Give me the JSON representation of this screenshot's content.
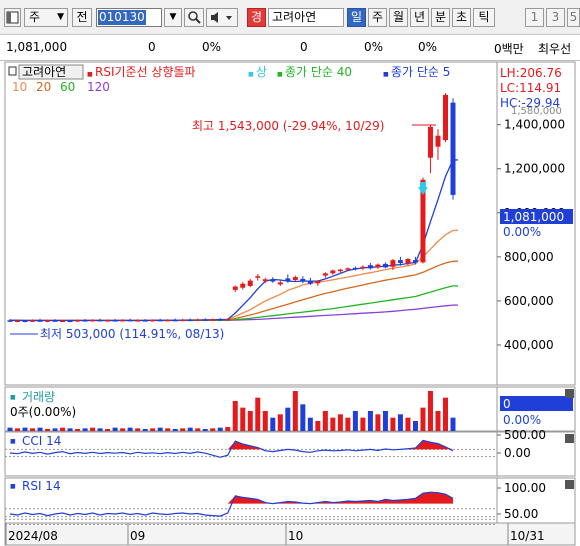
{
  "toolbar": {
    "type_label": "주",
    "type_arrow": "▼",
    "jeon_label": "전",
    "code": "010130",
    "code_dropdown": "▼",
    "search_icon": "search-icon",
    "sound_icon": "speaker-icon",
    "warning_badge": "경",
    "stock_name": "고려아연",
    "periods": [
      "일",
      "주",
      "월",
      "년",
      "분",
      "초",
      "틱"
    ],
    "active_period": "일",
    "number_buttons": [
      "1",
      "3",
      "5"
    ]
  },
  "quote_bar": {
    "price": "1,081,000",
    "change": "0",
    "change_pct": "0%",
    "volume": "0",
    "volume_pct": "0%",
    "extra_pct": "0%",
    "amount": "0백만",
    "trailing": "최우선"
  },
  "price_panel": {
    "legend": {
      "stock": "고려아연",
      "rsi_label": "RSI기준선 상향돌파",
      "arrow_label": "상",
      "ma40": "종가 단순 40",
      "ma5": "종가 단순 5",
      "ma_periods": [
        "10",
        "20",
        "60",
        "120"
      ]
    },
    "lh": "LH:206.76",
    "lc": "LC:114.91",
    "hc": "HC:-29.94",
    "high_annotation": "최고 1,543,000 (-29.94%, 10/29)",
    "low_annotation": "최저 503,000 (114.91%, 08/13)",
    "y_ticks": [
      "1,400,000",
      "1,200,000",
      "1,000,000",
      "800,000",
      "600,000",
      "400,000"
    ],
    "top_clipped_tick": "1,580,000",
    "current_price": "1,081,000",
    "current_pct": "0.00%",
    "colors": {
      "up": "#e41a1c",
      "down": "#1f3fd8",
      "ma5": "#1f3fd8",
      "ma10": "#f08a4b",
      "ma20": "#d2691e",
      "ma60": "#22b522",
      "ma120": "#8b3fd8"
    }
  },
  "volume_panel": {
    "label": "거래량",
    "value": "0주(0.00%)",
    "axis_value": "0",
    "axis_pct": "0.00%"
  },
  "cci_panel": {
    "label": "CCI 14",
    "ticks": [
      "500.00",
      "0.00"
    ]
  },
  "rsi_panel": {
    "label": "RSI 14",
    "ticks": [
      "100.00",
      "50.00"
    ]
  },
  "date_axis": {
    "labels": [
      "2024/08",
      "09",
      "10",
      "10/31"
    ]
  },
  "chart_data": {
    "type": "candlestick",
    "title": "고려아연",
    "xlabel": "",
    "ylabel": "",
    "ylim": [
      300000,
      1580000
    ],
    "dates_range": [
      "2024/08",
      "10/31"
    ],
    "candles": [
      {
        "d": "08/01",
        "o": 512000,
        "h": 518000,
        "l": 505000,
        "c": 509000
      },
      {
        "d": "08/02",
        "o": 509000,
        "h": 515000,
        "l": 503000,
        "c": 511000
      },
      {
        "d": "08/05",
        "o": 511000,
        "h": 514000,
        "l": 503000,
        "c": 506000
      },
      {
        "d": "08/06",
        "o": 506000,
        "h": 516000,
        "l": 504000,
        "c": 512000
      },
      {
        "d": "08/07",
        "o": 512000,
        "h": 519000,
        "l": 506000,
        "c": 508000
      },
      {
        "d": "08/08",
        "o": 508000,
        "h": 515000,
        "l": 503000,
        "c": 512000
      },
      {
        "d": "08/09",
        "o": 512000,
        "h": 517000,
        "l": 507000,
        "c": 509000
      },
      {
        "d": "08/12",
        "o": 509000,
        "h": 514000,
        "l": 504000,
        "c": 511000
      },
      {
        "d": "08/13",
        "o": 511000,
        "h": 515000,
        "l": 503000,
        "c": 507000
      },
      {
        "d": "08/14",
        "o": 507000,
        "h": 516000,
        "l": 505000,
        "c": 513000
      },
      {
        "d": "08/16",
        "o": 513000,
        "h": 518000,
        "l": 507000,
        "c": 510000
      },
      {
        "d": "08/19",
        "o": 510000,
        "h": 517000,
        "l": 506000,
        "c": 514000
      },
      {
        "d": "08/20",
        "o": 514000,
        "h": 519000,
        "l": 509000,
        "c": 511000
      },
      {
        "d": "08/21",
        "o": 511000,
        "h": 516000,
        "l": 507000,
        "c": 513000
      },
      {
        "d": "08/22",
        "o": 513000,
        "h": 518000,
        "l": 508000,
        "c": 510000
      },
      {
        "d": "08/23",
        "o": 510000,
        "h": 517000,
        "l": 506000,
        "c": 514000
      },
      {
        "d": "08/26",
        "o": 514000,
        "h": 519000,
        "l": 509000,
        "c": 511000
      },
      {
        "d": "08/27",
        "o": 511000,
        "h": 517000,
        "l": 507000,
        "c": 513000
      },
      {
        "d": "08/28",
        "o": 513000,
        "h": 518000,
        "l": 508000,
        "c": 510000
      },
      {
        "d": "08/29",
        "o": 510000,
        "h": 516000,
        "l": 506000,
        "c": 514000
      },
      {
        "d": "08/30",
        "o": 514000,
        "h": 519000,
        "l": 509000,
        "c": 512000
      },
      {
        "d": "09/02",
        "o": 512000,
        "h": 517000,
        "l": 507000,
        "c": 514000
      },
      {
        "d": "09/03",
        "o": 514000,
        "h": 520000,
        "l": 509000,
        "c": 513000
      },
      {
        "d": "09/04",
        "o": 513000,
        "h": 519000,
        "l": 508000,
        "c": 515000
      },
      {
        "d": "09/05",
        "o": 515000,
        "h": 520000,
        "l": 510000,
        "c": 514000
      },
      {
        "d": "09/06",
        "o": 514000,
        "h": 520000,
        "l": 509000,
        "c": 516000
      },
      {
        "d": "09/09",
        "o": 516000,
        "h": 521000,
        "l": 511000,
        "c": 514000
      },
      {
        "d": "09/10",
        "o": 514000,
        "h": 520000,
        "l": 510000,
        "c": 517000
      },
      {
        "d": "09/11",
        "o": 517000,
        "h": 522000,
        "l": 512000,
        "c": 515000
      },
      {
        "d": "09/12",
        "o": 515000,
        "h": 521000,
        "l": 511000,
        "c": 518000
      },
      {
        "d": "09/13",
        "o": 650000,
        "h": 670000,
        "l": 640000,
        "c": 665000
      },
      {
        "d": "09/19",
        "o": 660000,
        "h": 685000,
        "l": 652000,
        "c": 678000
      },
      {
        "d": "09/20",
        "o": 668000,
        "h": 700000,
        "l": 662000,
        "c": 692000
      },
      {
        "d": "09/23",
        "o": 705000,
        "h": 722000,
        "l": 692000,
        "c": 712000
      },
      {
        "d": "09/24",
        "o": 690000,
        "h": 705000,
        "l": 680000,
        "c": 698000
      },
      {
        "d": "09/25",
        "o": 698000,
        "h": 708000,
        "l": 682000,
        "c": 688000
      },
      {
        "d": "09/26",
        "o": 675000,
        "h": 692000,
        "l": 668000,
        "c": 684000
      },
      {
        "d": "09/27",
        "o": 702000,
        "h": 720000,
        "l": 682000,
        "c": 690000
      },
      {
        "d": "09/30",
        "o": 695000,
        "h": 715000,
        "l": 688000,
        "c": 708000
      },
      {
        "d": "10/02",
        "o": 700000,
        "h": 712000,
        "l": 680000,
        "c": 688000
      },
      {
        "d": "10/04",
        "o": 690000,
        "h": 705000,
        "l": 672000,
        "c": 678000
      },
      {
        "d": "10/07",
        "o": 680000,
        "h": 694000,
        "l": 668000,
        "c": 690000
      },
      {
        "d": "10/08",
        "o": 715000,
        "h": 730000,
        "l": 705000,
        "c": 725000
      },
      {
        "d": "10/10",
        "o": 725000,
        "h": 742000,
        "l": 718000,
        "c": 738000
      },
      {
        "d": "10/11",
        "o": 735000,
        "h": 746000,
        "l": 726000,
        "c": 742000
      },
      {
        "d": "10/14",
        "o": 742000,
        "h": 752000,
        "l": 735000,
        "c": 748000
      },
      {
        "d": "10/15",
        "o": 750000,
        "h": 756000,
        "l": 738000,
        "c": 744000
      },
      {
        "d": "10/16",
        "o": 748000,
        "h": 762000,
        "l": 740000,
        "c": 755000
      },
      {
        "d": "10/17",
        "o": 762000,
        "h": 772000,
        "l": 742000,
        "c": 748000
      },
      {
        "d": "10/18",
        "o": 752000,
        "h": 770000,
        "l": 745000,
        "c": 765000
      },
      {
        "d": "10/21",
        "o": 768000,
        "h": 775000,
        "l": 748000,
        "c": 752000
      },
      {
        "d": "10/22",
        "o": 755000,
        "h": 790000,
        "l": 740000,
        "c": 785000
      },
      {
        "d": "10/23",
        "o": 785000,
        "h": 800000,
        "l": 760000,
        "c": 772000
      },
      {
        "d": "10/24",
        "o": 770000,
        "h": 795000,
        "l": 760000,
        "c": 790000
      },
      {
        "d": "10/25",
        "o": 785000,
        "h": 800000,
        "l": 766000,
        "c": 775000
      },
      {
        "d": "10/28",
        "o": 775000,
        "h": 1160000,
        "l": 770000,
        "c": 1150000
      },
      {
        "d": "10/29a",
        "o": 1250000,
        "h": 1400000,
        "l": 1180000,
        "c": 1390000
      },
      {
        "d": "10/29b",
        "o": 1300000,
        "h": 1380000,
        "l": 1240000,
        "c": 1350000
      },
      {
        "d": "10/29",
        "o": 1330000,
        "h": 1543000,
        "l": 1320000,
        "c": 1535000
      },
      {
        "d": "10/30",
        "o": 1500000,
        "h": 1520000,
        "l": 1060000,
        "c": 1081000
      }
    ],
    "ma5": [
      512000,
      512000,
      511000,
      511000,
      511000,
      511000,
      511000,
      511000,
      511000,
      511000,
      511000,
      511000,
      511000,
      511000,
      511000,
      511000,
      511000,
      511000,
      511000,
      512000,
      512000,
      512000,
      512000,
      513000,
      513000,
      513000,
      514000,
      514000,
      515000,
      516000,
      545000,
      580000,
      615000,
      655000,
      690000,
      697000,
      695000,
      690000,
      688000,
      690000,
      690000,
      690000,
      700000,
      712000,
      725000,
      738000,
      745000,
      750000,
      752000,
      755000,
      758000,
      762000,
      765000,
      770000,
      775000,
      855000,
      960000,
      1060000,
      1165000,
      1240000,
      1250000
    ],
    "ma10": [
      512000,
      512000,
      512000,
      512000,
      512000,
      512000,
      512000,
      512000,
      512000,
      512000,
      512000,
      512000,
      512000,
      512000,
      512000,
      512000,
      512000,
      512000,
      512000,
      513000,
      513000,
      513000,
      513000,
      513000,
      514000,
      514000,
      514000,
      515000,
      515000,
      516000,
      530000,
      545000,
      560000,
      580000,
      600000,
      615000,
      630000,
      648000,
      660000,
      672000,
      680000,
      686000,
      690000,
      696000,
      702000,
      708000,
      715000,
      722000,
      728000,
      735000,
      742000,
      748000,
      754000,
      760000,
      768000,
      800000,
      835000,
      870000,
      900000,
      920000,
      935000
    ],
    "ma20": [
      512000,
      512000,
      512000,
      512000,
      512000,
      512000,
      512000,
      512000,
      512000,
      512000,
      512000,
      512000,
      512000,
      512000,
      512000,
      512000,
      512000,
      512000,
      512000,
      512000,
      512000,
      512000,
      512000,
      512000,
      513000,
      513000,
      513000,
      513000,
      514000,
      514000,
      520000,
      528000,
      536000,
      545000,
      555000,
      565000,
      575000,
      585000,
      595000,
      605000,
      615000,
      625000,
      634000,
      642000,
      650000,
      658000,
      665000,
      672000,
      680000,
      687000,
      694000,
      700000,
      706000,
      712000,
      718000,
      730000,
      745000,
      760000,
      772000,
      780000,
      785000
    ],
    "ma60": [
      512000,
      512000,
      512000,
      512000,
      512000,
      512000,
      512000,
      512000,
      512000,
      512000,
      512000,
      512000,
      512000,
      512000,
      512000,
      512000,
      512000,
      512000,
      512000,
      512000,
      512000,
      512000,
      512000,
      512000,
      512000,
      512000,
      512000,
      512000,
      512000,
      513000,
      515000,
      518000,
      521000,
      525000,
      529000,
      533000,
      537000,
      541000,
      545000,
      549000,
      553000,
      557000,
      561000,
      565000,
      570000,
      575000,
      580000,
      585000,
      590000,
      595000,
      600000,
      605000,
      610000,
      615000,
      620000,
      630000,
      640000,
      650000,
      660000,
      668000,
      675000
    ],
    "ma120": [
      512000,
      512000,
      512000,
      512000,
      512000,
      512000,
      512000,
      512000,
      512000,
      512000,
      512000,
      512000,
      512000,
      512000,
      512000,
      512000,
      512000,
      512000,
      512000,
      512000,
      512000,
      512000,
      512000,
      512000,
      512000,
      512000,
      512000,
      512000,
      512000,
      512000,
      513000,
      514000,
      515000,
      516000,
      518000,
      520000,
      522000,
      524000,
      526000,
      528000,
      530000,
      532000,
      534000,
      536000,
      538000,
      540000,
      542000,
      544000,
      546000,
      548000,
      550000,
      553000,
      556000,
      559000,
      562000,
      566000,
      570000,
      574000,
      578000,
      581000,
      584000
    ],
    "volume": [
      0.05,
      0.04,
      0.05,
      0.04,
      0.05,
      0.03,
      0.04,
      0.05,
      0.04,
      0.03,
      0.04,
      0.05,
      0.04,
      0.03,
      0.05,
      0.04,
      0.05,
      0.04,
      0.03,
      0.04,
      0.05,
      0.04,
      0.03,
      0.04,
      0.05,
      0.04,
      0.03,
      0.04,
      0.05,
      0.06,
      0.45,
      0.35,
      0.3,
      0.5,
      0.3,
      0.2,
      0.25,
      0.35,
      0.6,
      0.4,
      0.2,
      0.15,
      0.3,
      0.2,
      0.25,
      0.2,
      0.3,
      0.2,
      0.3,
      0.25,
      0.3,
      0.2,
      0.25,
      0.2,
      0.15,
      0.35,
      0.6,
      0.3,
      0.5,
      0.2,
      0.2
    ],
    "cci": [
      0,
      -20,
      30,
      -10,
      20,
      -30,
      10,
      40,
      -20,
      15,
      -10,
      20,
      -15,
      10,
      -5,
      15,
      -25,
      20,
      -10,
      5,
      -20,
      10,
      -15,
      20,
      -10,
      30,
      -5,
      -60,
      -120,
      -60,
      330,
      250,
      200,
      150,
      60,
      40,
      70,
      100,
      80,
      40,
      20,
      60,
      80,
      60,
      70,
      90,
      60,
      80,
      100,
      70,
      110,
      90,
      100,
      120,
      140,
      350,
      300,
      260,
      170,
      60,
      -40
    ],
    "rsi": [
      50,
      48,
      52,
      49,
      51,
      47,
      50,
      52,
      48,
      51,
      49,
      52,
      48,
      51,
      50,
      52,
      49,
      51,
      48,
      52,
      50,
      49,
      51,
      52,
      50,
      51,
      48,
      47,
      46,
      52,
      85,
      82,
      80,
      78,
      72,
      70,
      72,
      74,
      73,
      71,
      70,
      72,
      74,
      72,
      73,
      75,
      74,
      75,
      76,
      74,
      78,
      76,
      77,
      78,
      80,
      90,
      92,
      91,
      88,
      80,
      60
    ]
  }
}
